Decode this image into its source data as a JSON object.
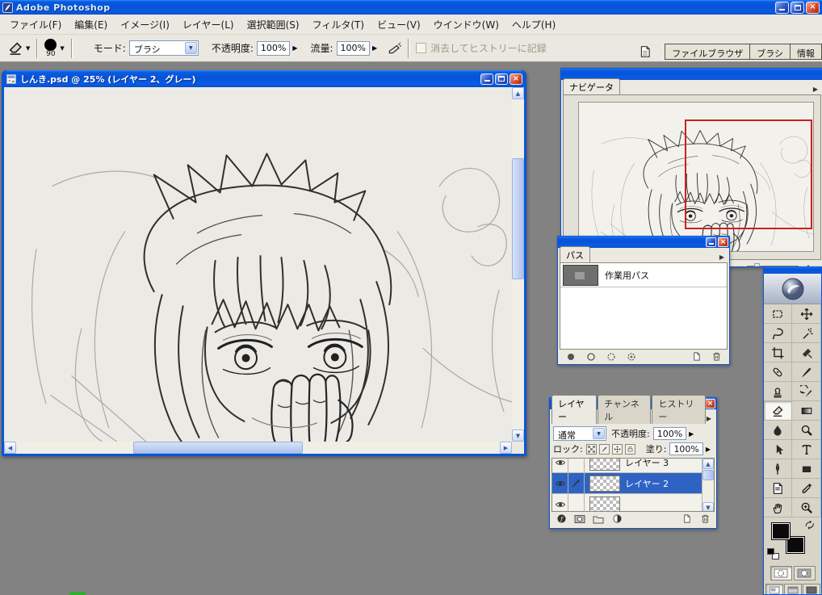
{
  "app": {
    "title": "Adobe Photoshop"
  },
  "menubar": {
    "items": [
      "ファイル(F)",
      "編集(E)",
      "イメージ(I)",
      "レイヤー(L)",
      "選択範囲(S)",
      "フィルタ(T)",
      "ビュー(V)",
      "ウインドウ(W)",
      "ヘルプ(H)"
    ]
  },
  "options": {
    "brush_size": "90",
    "mode_label": "モード:",
    "mode_value": "ブラシ",
    "opacity_label": "不透明度:",
    "opacity_value": "100%",
    "flow_label": "流量:",
    "flow_value": "100%",
    "erase_to_history": "消去してヒストリーに記録",
    "well_tabs": [
      "ファイルブラウザ",
      "ブラシ",
      "情報"
    ]
  },
  "document": {
    "title": "しんき.psd @ 25% (レイヤー 2、グレー)"
  },
  "navigator": {
    "tab": "ナビゲータ"
  },
  "paths": {
    "tab": "パス",
    "work_path": "作業用パス"
  },
  "layers": {
    "tabs": [
      "レイヤー",
      "チャンネル",
      "ヒストリー"
    ],
    "blend_mode": "通常",
    "opacity_label": "不透明度:",
    "opacity_value": "100%",
    "lock_label": "ロック:",
    "fill_label": "塗り:",
    "fill_value": "100%",
    "rows": [
      {
        "name": "レイヤー 3"
      },
      {
        "name": "レイヤー 2"
      }
    ],
    "selected_row": "レイヤー 2"
  },
  "toolbox": {
    "tools": [
      "rectangular-marquee",
      "move",
      "lasso",
      "magic-wand",
      "crop",
      "slice",
      "healing-brush",
      "brush",
      "clone-stamp",
      "history-brush",
      "eraser",
      "gradient",
      "blur",
      "dodge",
      "path-selection",
      "type",
      "pen",
      "shape",
      "notes",
      "eyedropper",
      "hand",
      "zoom"
    ],
    "selected_tool": "eraser"
  },
  "colors": {
    "titlebar_blue": "#0a55da",
    "selection_blue": "#2e63c4",
    "close_red": "#dd5334",
    "workspace_gray": "#828282",
    "navigator_view_rect": "#cf1f1f",
    "foreground": "#0a0a0a",
    "background": "#0a0a0a"
  }
}
